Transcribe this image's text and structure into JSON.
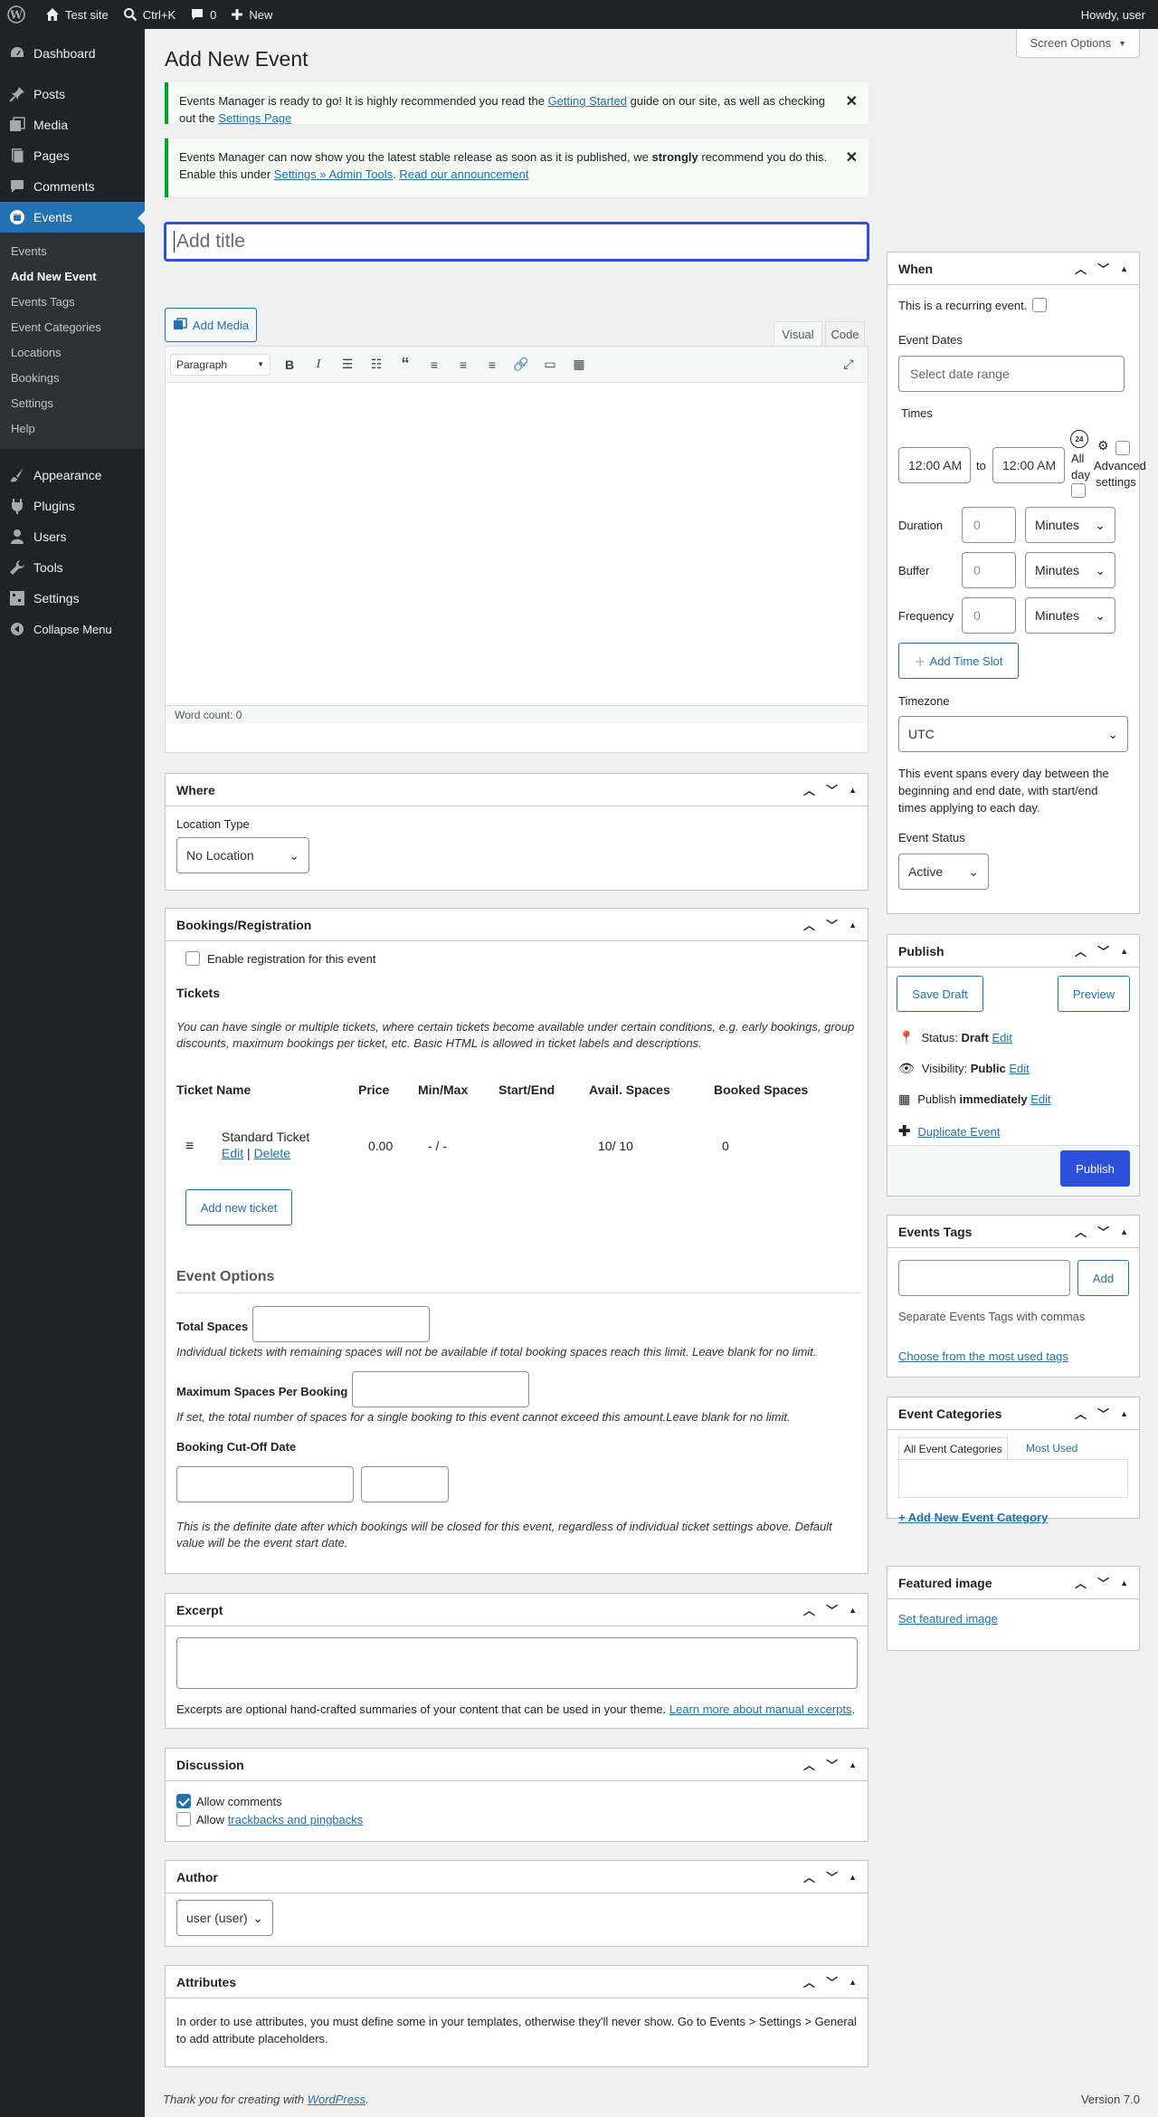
{
  "adminbar": {
    "site": "Test site",
    "shortcut": "Ctrl+K",
    "comments": "0",
    "new": "New",
    "howdy": "Howdy, user"
  },
  "sidebar": {
    "items": [
      {
        "label": "Dashboard",
        "icon": "dashboard-icon"
      },
      {
        "label": "Posts",
        "icon": "pin-icon"
      },
      {
        "label": "Media",
        "icon": "media-icon"
      },
      {
        "label": "Pages",
        "icon": "pages-icon"
      },
      {
        "label": "Comments",
        "icon": "comments-icon"
      },
      {
        "label": "Events",
        "icon": "calendar-icon"
      }
    ],
    "submenu": [
      "Events",
      "Add New Event",
      "Events Tags",
      "Event Categories",
      "Locations",
      "Bookings",
      "Settings",
      "Help"
    ],
    "items2": [
      {
        "label": "Appearance"
      },
      {
        "label": "Plugins"
      },
      {
        "label": "Users"
      },
      {
        "label": "Tools"
      },
      {
        "label": "Settings"
      },
      {
        "label": "Collapse Menu"
      }
    ]
  },
  "page": {
    "title": "Add New Event",
    "screen_options": "Screen Options"
  },
  "notices": {
    "n1_a": "Events Manager is ready to go! It is highly recommended you read the ",
    "n1_link1": "Getting Started",
    "n1_b": " guide on our site, as well as checking out the ",
    "n1_link2": "Settings Page",
    "n2_a": "Events Manager can now show you the latest stable release as soon as it is published, we ",
    "n2_strong": "strongly",
    "n2_b": " recommend you do this. Enable this under ",
    "n2_link1": "Settings » Admin Tools",
    "n2_c": ". ",
    "n2_link2": "Read our announcement"
  },
  "editor": {
    "title_placeholder": "Add title",
    "add_media": "Add Media",
    "tab_visual": "Visual",
    "tab_code": "Code",
    "paragraph": "Paragraph",
    "word_count": "Word count: 0"
  },
  "where": {
    "title": "Where",
    "location_type_label": "Location Type",
    "location_type": "No Location"
  },
  "bookings": {
    "title": "Bookings/Registration",
    "enable": "Enable registration for this event",
    "tickets_heading": "Tickets",
    "tickets_desc": "You can have single or multiple tickets, where certain tickets become available under certain conditions, e.g. early bookings, group discounts, maximum bookings per ticket, etc. Basic HTML is allowed in ticket labels and descriptions.",
    "columns": [
      "Ticket Name",
      "Price",
      "Min/Max",
      "Start/End",
      "Avail. Spaces",
      "Booked Spaces"
    ],
    "ticket": {
      "name": "Standard Ticket",
      "edit": "Edit",
      "sep": "|",
      "delete": "Delete",
      "price": "0.00",
      "minmax": "- / -",
      "avail": "10/ 10",
      "booked": "0"
    },
    "add_ticket": "Add new ticket",
    "options_heading": "Event Options",
    "total_spaces": "Total Spaces",
    "total_spaces_desc": "Individual tickets with remaining spaces will not be available if total booking spaces reach this limit. Leave blank for no limit.",
    "max_spaces": "Maximum Spaces Per Booking",
    "max_spaces_desc": "If set, the total number of spaces for a single booking to this event cannot exceed this amount.Leave blank for no limit.",
    "cutoff": "Booking Cut-Off Date",
    "cutoff_desc": "This is the definite date after which bookings will be closed for this event, regardless of individual ticket settings above. Default value will be the event start date."
  },
  "excerpt": {
    "title": "Excerpt",
    "desc_a": "Excerpts are optional hand-crafted summaries of your content that can be used in your theme. ",
    "desc_link": "Learn more about manual excerpts",
    "desc_b": "."
  },
  "discussion": {
    "title": "Discussion",
    "allow_comments": "Allow comments",
    "allow": "Allow ",
    "trackbacks": "trackbacks and pingbacks"
  },
  "author": {
    "title": "Author",
    "value": "user (user)"
  },
  "attributes": {
    "title": "Attributes",
    "desc": "In order to use attributes, you must define some in your templates, otherwise they'll never show. Go to Events > Settings > General to add attribute placeholders."
  },
  "when": {
    "title": "When",
    "recurring": "This is a recurring event.",
    "event_dates": "Event Dates",
    "date_placeholder": "Select date range",
    "times": "Times",
    "time_start": "12:00 AM",
    "to": "to",
    "time_end": "12:00 AM",
    "all": "All",
    "day": "day",
    "advanced": "Advanced",
    "settings": "settings",
    "badge": "24",
    "duration": "Duration",
    "buffer": "Buffer",
    "frequency": "Frequency",
    "zero": "0",
    "minutes": "Minutes",
    "add_slot": "Add Time Slot",
    "timezone_label": "Timezone",
    "timezone": "UTC",
    "span_desc": "This event spans every day between the beginning and end date, with start/end times applying to each day.",
    "status_label": "Event Status",
    "status": "Active"
  },
  "publish": {
    "title": "Publish",
    "save_draft": "Save Draft",
    "preview": "Preview",
    "status_label": "Status: ",
    "status": "Draft",
    "edit": "Edit",
    "visibility_label": "Visibility: ",
    "visibility": "Public",
    "publish_label": "Publish ",
    "publish_when": "immediately",
    "duplicate": "Duplicate Event",
    "publish_btn": "Publish"
  },
  "tags": {
    "title": "Events Tags",
    "add": "Add",
    "desc": "Separate Events Tags with commas",
    "choose": "Choose from the most used tags"
  },
  "categories": {
    "title": "Event Categories",
    "tab_all": "All Event Categories",
    "tab_most": "Most Used",
    "add_new": "+ Add New Event Category"
  },
  "featured": {
    "title": "Featured image",
    "set": "Set featured image"
  },
  "footer": {
    "thanks": "Thank you for creating with ",
    "wp": "WordPress",
    "dot": ".",
    "version": "Version 7.0"
  }
}
